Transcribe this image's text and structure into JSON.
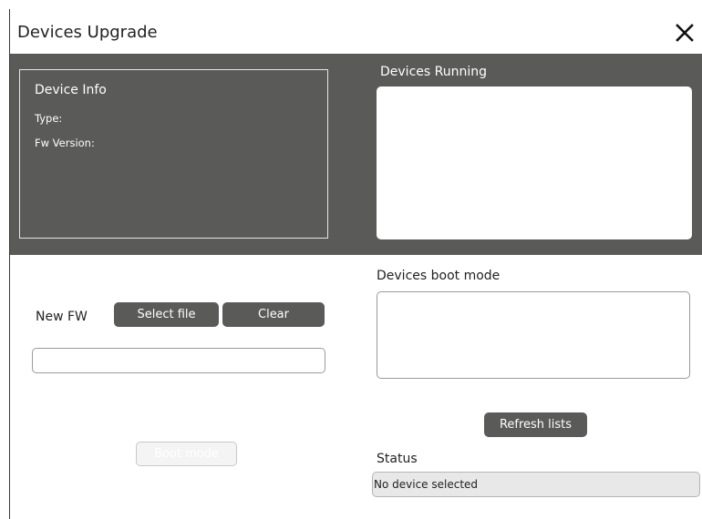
{
  "window": {
    "title": "Devices Upgrade",
    "close_icon": "close-icon"
  },
  "device_info": {
    "heading": "Device Info",
    "type_label": "Type:",
    "fw_version_label": "Fw Version:"
  },
  "devices_running": {
    "label": "Devices Running",
    "items": []
  },
  "new_fw": {
    "label": "New FW",
    "select_file_label": "Select file",
    "clear_label": "Clear",
    "file_path_value": ""
  },
  "boot_mode_button": {
    "label": "Boot mode",
    "enabled": false
  },
  "devices_boot_mode": {
    "label": "Devices boot mode",
    "items": []
  },
  "refresh_label": "Refresh lists",
  "status": {
    "label": "Status",
    "value": "No device selected"
  },
  "colors": {
    "panel": "#5a5a59",
    "button": "#5a5a59",
    "button_text": "#ffffff",
    "status_background": "#e8e8e8"
  }
}
